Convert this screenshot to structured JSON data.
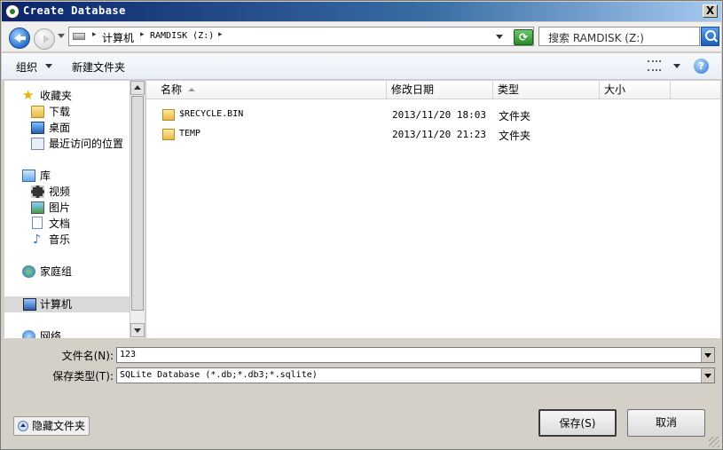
{
  "window": {
    "title": "Create Database",
    "close_label": "X"
  },
  "address": {
    "crumbs": [
      "计算机",
      "RAMDISK (Z:)"
    ],
    "separator": "▸",
    "search_placeholder": "搜索 RAMDISK (Z:)"
  },
  "toolbar": {
    "organize": "组织",
    "new_folder": "新建文件夹",
    "help": "?"
  },
  "nav": {
    "favorites": "收藏夹",
    "downloads": "下载",
    "desktop": "桌面",
    "recent": "最近访问的位置",
    "libraries": "库",
    "videos": "视频",
    "pictures": "图片",
    "documents": "文档",
    "music": "音乐",
    "homegroup": "家庭组",
    "computer": "计算机",
    "network": "网络"
  },
  "columns": {
    "name": "名称",
    "modified": "修改日期",
    "type": "类型",
    "size": "大小"
  },
  "files": [
    {
      "name": "$RECYCLE.BIN",
      "modified": "2013/11/20 18:03",
      "type": "文件夹"
    },
    {
      "name": "TEMP",
      "modified": "2013/11/20 21:23",
      "type": "文件夹"
    }
  ],
  "form": {
    "filename_label": "文件名(N):",
    "filename_value": "123",
    "filetype_label": "保存类型(T):",
    "filetype_value": "SQLite Database (*.db;*.db3;*.sqlite)"
  },
  "buttons": {
    "hide_folders": "隐藏文件夹",
    "save": "保存(S)",
    "cancel": "取消"
  }
}
